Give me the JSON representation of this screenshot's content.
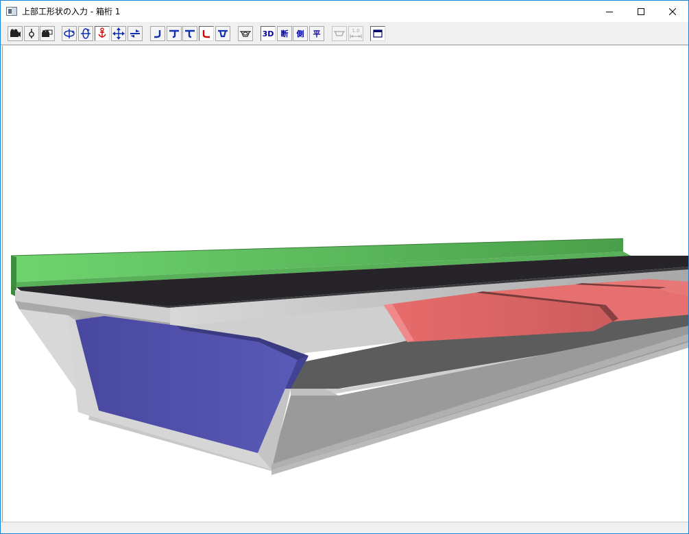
{
  "window": {
    "title": "上部工形状の入力 - 箱桁 1",
    "controls": [
      "minimize-icon",
      "maximize-icon",
      "close-icon"
    ]
  },
  "toolbar": {
    "view_3d_label": "3D",
    "view_section_label": "断",
    "view_side_label": "側",
    "view_plan_label": "平",
    "scale_label": "1.0",
    "icons": [
      "camera-icon",
      "light-icon",
      "camera-multi-icon",
      "rotate-x-icon",
      "rotate-y-icon",
      "anchor-icon",
      "move-icon",
      "flip-icon",
      "girder-left-icon",
      "girder-tee-left-icon",
      "girder-tee-right-icon",
      "girder-right-icon",
      "girder-box-icon",
      "bowl-icon",
      "view-3d-icon",
      "view-section-icon",
      "view-side-icon",
      "view-plan-icon",
      "dimension-icon",
      "scale-icon",
      "window-toggle-icon"
    ]
  },
  "colors": {
    "accent": "#1883d7",
    "railing": "#5ec05e",
    "pavement": "#2a2a2a",
    "concrete": "#bdbdbd",
    "diaphragm_blue": "#5454aa",
    "diaphragm_red": "#e56a6a"
  },
  "statusbar": {
    "text": ""
  }
}
